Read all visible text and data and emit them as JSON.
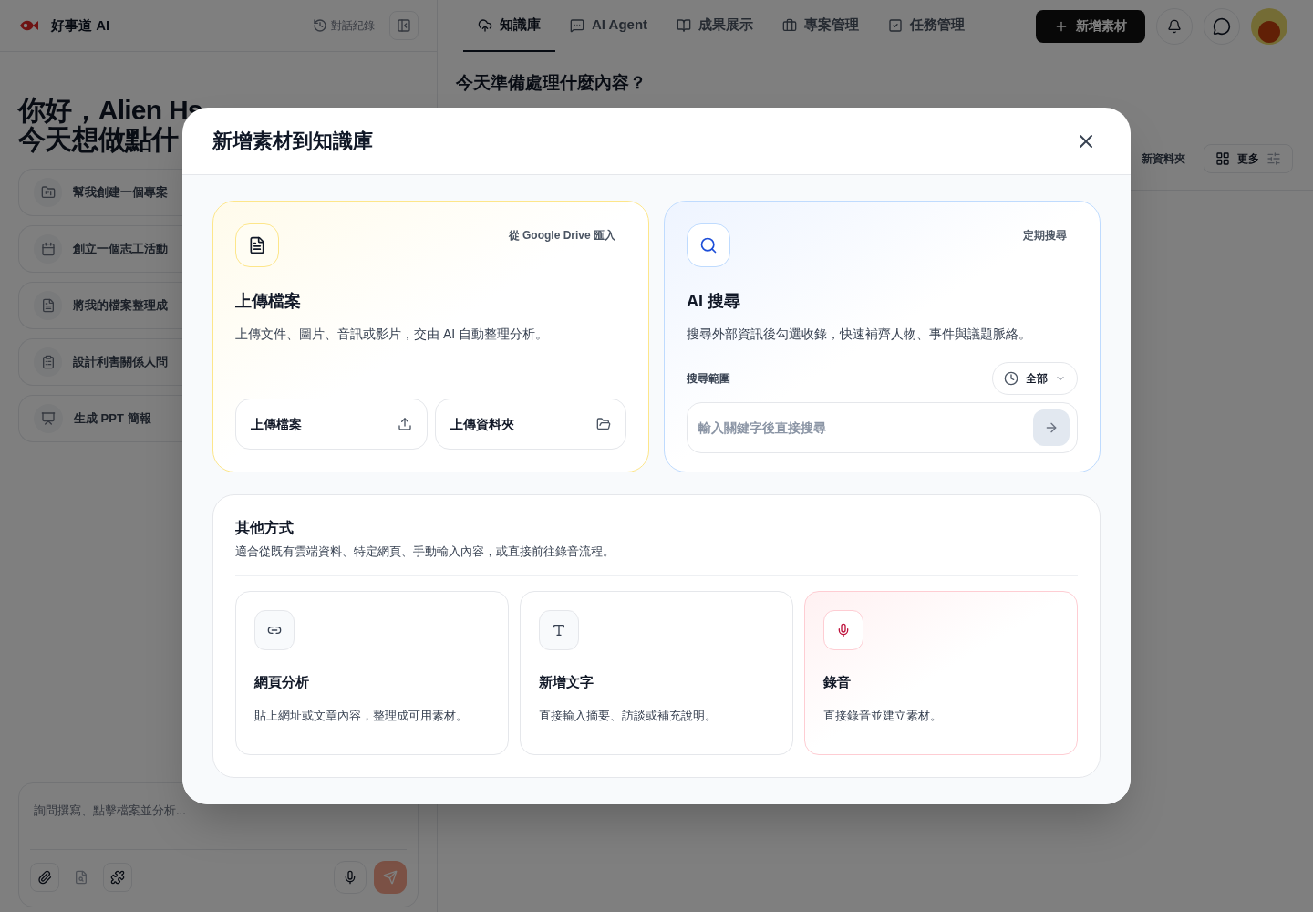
{
  "app": {
    "name": "好事道 AI",
    "history_label": "對話紀錄"
  },
  "sidebar": {
    "greeting": [
      "你好，Alien Hs",
      "今天想做點什"
    ],
    "suggestions": [
      {
        "label": "幫我創建一個專案"
      },
      {
        "label": "創立一個志工活動"
      },
      {
        "label": "將我的檔案整理成"
      },
      {
        "label": "設計利害關係人問"
      },
      {
        "label": "生成 PPT 簡報"
      }
    ],
    "chat_input": {
      "placeholder": "詢問撰寫、點擊檔案並分析..."
    }
  },
  "nav": {
    "tabs": [
      {
        "label": "知識庫",
        "selected": true
      },
      {
        "label": "AI Agent",
        "selected": false
      },
      {
        "label": "成果展示",
        "selected": false
      },
      {
        "label": "專案管理",
        "selected": false
      },
      {
        "label": "任務管理",
        "selected": false
      }
    ],
    "primary_button": "新增素材"
  },
  "main": {
    "heading": "今天準備處理什麼內容？",
    "new_folder": "新資料夾",
    "more_button": "更多"
  },
  "dialog": {
    "title": "新增素材到知識庫",
    "upload": {
      "link": "從 Google Drive 匯入",
      "title": "上傳檔案",
      "description": "上傳文件、圖片、音訊或影片，交由 AI 自動整理分析。",
      "buttons": [
        "上傳檔案",
        "上傳資料夾"
      ]
    },
    "search": {
      "link": "定期搜尋",
      "title": "AI 搜尋",
      "description": "搜尋外部資訊後勾選收錄，快速補齊人物、事件與議題脈絡。",
      "scope_label": "搜尋範圍",
      "scope_value": "全部",
      "placeholder": "輸入關鍵字後直接搜尋"
    },
    "other": {
      "title": "其他方式",
      "description": "適合從既有雲端資料、特定網頁、手動輸入內容，或直接前往錄音流程。",
      "options": [
        {
          "title": "網頁分析",
          "description": "貼上網址或文章內容，整理成可用素材。",
          "accent": false
        },
        {
          "title": "新增文字",
          "description": "直接輸入摘要、訪談或補充說明。",
          "accent": false
        },
        {
          "title": "錄音",
          "description": "直接錄音並建立素材。",
          "accent": true
        }
      ]
    }
  }
}
